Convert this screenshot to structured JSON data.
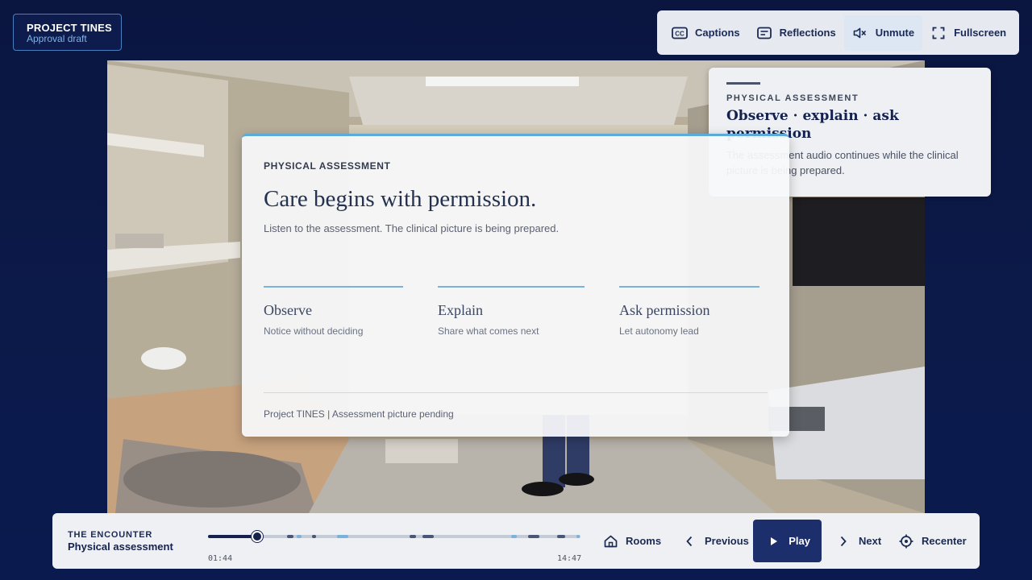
{
  "project": {
    "name": "PROJECT TINES",
    "status": "Approval draft"
  },
  "toolbar": {
    "captions_label": "Captions",
    "reflections_label": "Reflections",
    "unmute_label": "Unmute",
    "fullscreen_label": "Fullscreen"
  },
  "info_card": {
    "kicker": "PHYSICAL ASSESSMENT",
    "title": "Observe · explain · ask permission",
    "text": "The assessment audio continues while the clinical picture is being prepared."
  },
  "card": {
    "kicker": "PHYSICAL ASSESSMENT",
    "title": "Care begins with permission.",
    "subtitle": "Listen to the assessment. The clinical picture is being prepared.",
    "pillars": [
      {
        "name": "Observe",
        "desc": "Notice without deciding"
      },
      {
        "name": "Explain",
        "desc": "Share what comes next"
      },
      {
        "name": "Ask permission",
        "desc": "Let autonomy lead"
      }
    ],
    "footer": "Project TINES | Assessment picture pending"
  },
  "player": {
    "chapter_kicker": "THE ENCOUNTER",
    "chapter_name": "Physical assessment",
    "current_time": "01:44",
    "total_time": "14:47",
    "progress": 0.131,
    "rooms_label": "Rooms",
    "previous_label": "Previous",
    "play_label": "Play",
    "next_label": "Next",
    "recenter_label": "Recenter"
  },
  "colors": {
    "accent": "#5da9d8",
    "navy": "#15224e",
    "play_button": "#1c2e6b",
    "background": "#0a1640"
  }
}
